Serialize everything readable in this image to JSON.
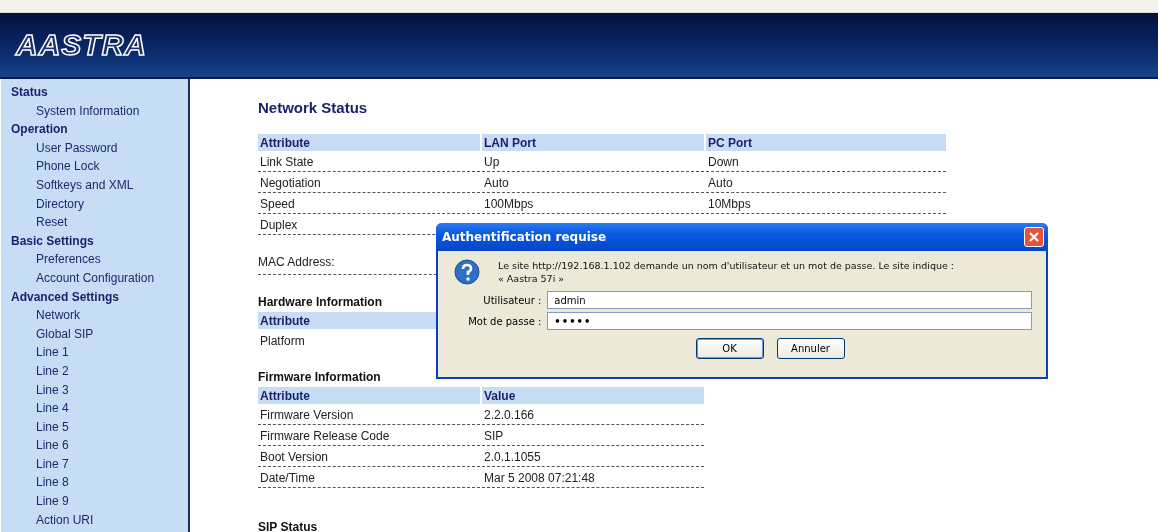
{
  "logo": "AASTRA",
  "sidebar": [
    {
      "label": "Status",
      "children": [
        {
          "label": "System Information"
        }
      ]
    },
    {
      "label": "Operation",
      "children": [
        {
          "label": "User Password"
        },
        {
          "label": "Phone Lock"
        },
        {
          "label": "Softkeys and XML"
        },
        {
          "label": "Directory"
        },
        {
          "label": "Reset"
        }
      ]
    },
    {
      "label": "Basic Settings",
      "children": [
        {
          "label": "Preferences"
        },
        {
          "label": "Account Configuration"
        }
      ]
    },
    {
      "label": "Advanced Settings",
      "children": [
        {
          "label": "Network"
        },
        {
          "label": "Global SIP"
        },
        {
          "label": "Line 1"
        },
        {
          "label": "Line 2"
        },
        {
          "label": "Line 3"
        },
        {
          "label": "Line 4"
        },
        {
          "label": "Line 5"
        },
        {
          "label": "Line 6"
        },
        {
          "label": "Line 7"
        },
        {
          "label": "Line 8"
        },
        {
          "label": "Line 9"
        },
        {
          "label": "Action URI"
        }
      ]
    }
  ],
  "page_title": "Network Status",
  "network_table": {
    "columns": [
      "Attribute",
      "LAN Port",
      "PC Port"
    ],
    "rows": [
      [
        "Link State",
        "Up",
        "Down"
      ],
      [
        "Negotiation",
        "Auto",
        "Auto"
      ],
      [
        "Speed",
        "100Mbps",
        "10Mbps"
      ],
      [
        "Duplex"
      ]
    ]
  },
  "mac_label": "MAC Address:",
  "hardware": {
    "title": "Hardware Information",
    "columns": [
      "Attribute"
    ],
    "rows": [
      [
        "Platform"
      ]
    ]
  },
  "firmware": {
    "title": "Firmware Information",
    "columns": [
      "Attribute",
      "Value"
    ],
    "rows": [
      [
        "Firmware Version",
        "2.2.0.166"
      ],
      [
        "Firmware Release Code",
        "SIP"
      ],
      [
        "Boot Version",
        "2.0.1.1055"
      ],
      [
        "Date/Time",
        "Mar 5 2008 07:21:48"
      ]
    ]
  },
  "sip_title": "SIP Status",
  "dialog": {
    "title": "Authentification requise",
    "message": "Le site http://192.168.1.102 demande un nom d'utilisateur et un mot de passe. Le site indique :",
    "realm": "« Aastra 57i »",
    "fields": [
      {
        "label": "Utilisateur :",
        "value": "admin",
        "kind": "text"
      },
      {
        "label": "Mot de passe :",
        "value": "•••••",
        "kind": "password"
      }
    ],
    "buttons": [
      "OK",
      "Annuler"
    ]
  }
}
